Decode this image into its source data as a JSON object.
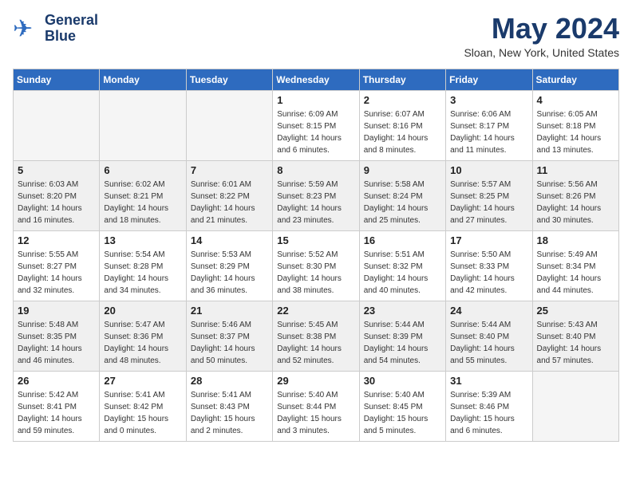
{
  "header": {
    "logo_line1": "General",
    "logo_line2": "Blue",
    "month_title": "May 2024",
    "location": "Sloan, New York, United States"
  },
  "weekdays": [
    "Sunday",
    "Monday",
    "Tuesday",
    "Wednesday",
    "Thursday",
    "Friday",
    "Saturday"
  ],
  "weeks": [
    [
      {
        "day": "",
        "empty": true
      },
      {
        "day": "",
        "empty": true
      },
      {
        "day": "",
        "empty": true
      },
      {
        "day": "1",
        "sunrise": "6:09 AM",
        "sunset": "8:15 PM",
        "daylight": "14 hours and 6 minutes."
      },
      {
        "day": "2",
        "sunrise": "6:07 AM",
        "sunset": "8:16 PM",
        "daylight": "14 hours and 8 minutes."
      },
      {
        "day": "3",
        "sunrise": "6:06 AM",
        "sunset": "8:17 PM",
        "daylight": "14 hours and 11 minutes."
      },
      {
        "day": "4",
        "sunrise": "6:05 AM",
        "sunset": "8:18 PM",
        "daylight": "14 hours and 13 minutes."
      }
    ],
    [
      {
        "day": "5",
        "sunrise": "6:03 AM",
        "sunset": "8:20 PM",
        "daylight": "14 hours and 16 minutes."
      },
      {
        "day": "6",
        "sunrise": "6:02 AM",
        "sunset": "8:21 PM",
        "daylight": "14 hours and 18 minutes."
      },
      {
        "day": "7",
        "sunrise": "6:01 AM",
        "sunset": "8:22 PM",
        "daylight": "14 hours and 21 minutes."
      },
      {
        "day": "8",
        "sunrise": "5:59 AM",
        "sunset": "8:23 PM",
        "daylight": "14 hours and 23 minutes."
      },
      {
        "day": "9",
        "sunrise": "5:58 AM",
        "sunset": "8:24 PM",
        "daylight": "14 hours and 25 minutes."
      },
      {
        "day": "10",
        "sunrise": "5:57 AM",
        "sunset": "8:25 PM",
        "daylight": "14 hours and 27 minutes."
      },
      {
        "day": "11",
        "sunrise": "5:56 AM",
        "sunset": "8:26 PM",
        "daylight": "14 hours and 30 minutes."
      }
    ],
    [
      {
        "day": "12",
        "sunrise": "5:55 AM",
        "sunset": "8:27 PM",
        "daylight": "14 hours and 32 minutes."
      },
      {
        "day": "13",
        "sunrise": "5:54 AM",
        "sunset": "8:28 PM",
        "daylight": "14 hours and 34 minutes."
      },
      {
        "day": "14",
        "sunrise": "5:53 AM",
        "sunset": "8:29 PM",
        "daylight": "14 hours and 36 minutes."
      },
      {
        "day": "15",
        "sunrise": "5:52 AM",
        "sunset": "8:30 PM",
        "daylight": "14 hours and 38 minutes."
      },
      {
        "day": "16",
        "sunrise": "5:51 AM",
        "sunset": "8:32 PM",
        "daylight": "14 hours and 40 minutes."
      },
      {
        "day": "17",
        "sunrise": "5:50 AM",
        "sunset": "8:33 PM",
        "daylight": "14 hours and 42 minutes."
      },
      {
        "day": "18",
        "sunrise": "5:49 AM",
        "sunset": "8:34 PM",
        "daylight": "14 hours and 44 minutes."
      }
    ],
    [
      {
        "day": "19",
        "sunrise": "5:48 AM",
        "sunset": "8:35 PM",
        "daylight": "14 hours and 46 minutes."
      },
      {
        "day": "20",
        "sunrise": "5:47 AM",
        "sunset": "8:36 PM",
        "daylight": "14 hours and 48 minutes."
      },
      {
        "day": "21",
        "sunrise": "5:46 AM",
        "sunset": "8:37 PM",
        "daylight": "14 hours and 50 minutes."
      },
      {
        "day": "22",
        "sunrise": "5:45 AM",
        "sunset": "8:38 PM",
        "daylight": "14 hours and 52 minutes."
      },
      {
        "day": "23",
        "sunrise": "5:44 AM",
        "sunset": "8:39 PM",
        "daylight": "14 hours and 54 minutes."
      },
      {
        "day": "24",
        "sunrise": "5:44 AM",
        "sunset": "8:40 PM",
        "daylight": "14 hours and 55 minutes."
      },
      {
        "day": "25",
        "sunrise": "5:43 AM",
        "sunset": "8:40 PM",
        "daylight": "14 hours and 57 minutes."
      }
    ],
    [
      {
        "day": "26",
        "sunrise": "5:42 AM",
        "sunset": "8:41 PM",
        "daylight": "14 hours and 59 minutes."
      },
      {
        "day": "27",
        "sunrise": "5:41 AM",
        "sunset": "8:42 PM",
        "daylight": "15 hours and 0 minutes."
      },
      {
        "day": "28",
        "sunrise": "5:41 AM",
        "sunset": "8:43 PM",
        "daylight": "15 hours and 2 minutes."
      },
      {
        "day": "29",
        "sunrise": "5:40 AM",
        "sunset": "8:44 PM",
        "daylight": "15 hours and 3 minutes."
      },
      {
        "day": "30",
        "sunrise": "5:40 AM",
        "sunset": "8:45 PM",
        "daylight": "15 hours and 5 minutes."
      },
      {
        "day": "31",
        "sunrise": "5:39 AM",
        "sunset": "8:46 PM",
        "daylight": "15 hours and 6 minutes."
      },
      {
        "day": "",
        "empty": true
      }
    ]
  ]
}
